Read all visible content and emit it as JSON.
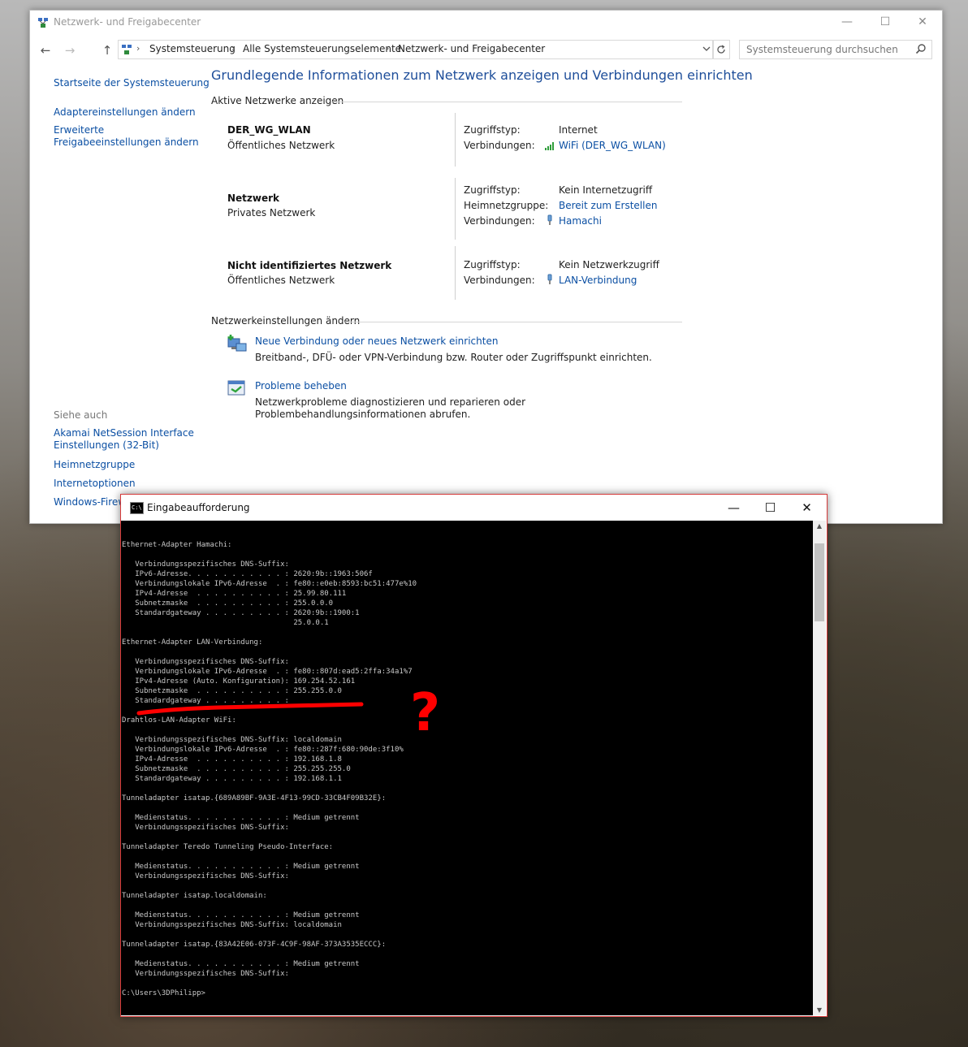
{
  "control_panel": {
    "title": "Netzwerk- und Freigabecenter",
    "window_controls": {
      "minimize": "—",
      "maximize": "☐",
      "close": "✕"
    },
    "nav": {
      "back": "←",
      "forward": "→",
      "up": "↑"
    },
    "breadcrumb": [
      "Systemsteuerung",
      "Alle Systemsteuerungselemente",
      "Netzwerk- und Freigabecenter"
    ],
    "breadcrumb_separator": "›",
    "search_placeholder": "Systemsteuerung durchsuchen",
    "sidebar": {
      "home": "Startseite der Systemsteuerung",
      "adapter": "Adaptereinstellungen ändern",
      "sharing_1": "Erweiterte",
      "sharing_2": "Freigabeeinstellungen ändern",
      "see_also": "Siehe auch",
      "akamai_1": "Akamai NetSession Interface",
      "akamai_2": "Einstellungen (32-Bit)",
      "homegroup": "Heimnetzgruppe",
      "internet_options": "Internetoptionen",
      "firewall": "Windows-Firewall"
    },
    "main_title": "Grundlegende Informationen zum Netzwerk anzeigen und Verbindungen einrichten",
    "active_networks_header": "Aktive Netzwerke anzeigen",
    "networks": [
      {
        "name": "DER_WG_WLAN",
        "type": "Öffentliches Netzwerk",
        "access_label": "Zugriffstyp:",
        "access_value": "Internet",
        "connections_label": "Verbindungen:",
        "connection": "WiFi (DER_WG_WLAN)"
      },
      {
        "name": "Netzwerk",
        "type": "Privates Netzwerk",
        "access_label": "Zugriffstyp:",
        "access_value": "Kein Internetzugriff",
        "homegroup_label": "Heimnetzgruppe:",
        "homegroup_value": "Bereit zum Erstellen",
        "connections_label": "Verbindungen:",
        "connection": "Hamachi"
      },
      {
        "name": "Nicht identifiziertes Netzwerk",
        "type": "Öffentliches Netzwerk",
        "access_label": "Zugriffstyp:",
        "access_value": "Kein Netzwerkzugriff",
        "connections_label": "Verbindungen:",
        "connection": "LAN-Verbindung"
      }
    ],
    "change_settings_header": "Netzwerkeinstellungen ändern",
    "tasks": [
      {
        "link": "Neue Verbindung oder neues Netzwerk einrichten",
        "desc": "Breitband-, DFÜ- oder VPN-Verbindung bzw. Router oder Zugriffspunkt einrichten.",
        "icon": "new-connection-icon"
      },
      {
        "link": "Probleme beheben",
        "desc": "Netzwerkprobleme diagnostizieren und reparieren oder Problembehandlungsinformationen abrufen.",
        "icon": "troubleshoot-icon"
      }
    ]
  },
  "cmd": {
    "title": "Eingabeaufforderung",
    "window_controls": {
      "minimize": "—",
      "maximize": "☐",
      "close": "✕"
    },
    "icon_label": "C:\\",
    "output": "Ethernet-Adapter Hamachi:\n\n   Verbindungsspezifisches DNS-Suffix:\n   IPv6-Adresse. . . . . . . . . . . : 2620:9b::1963:506f\n   Verbindungslokale IPv6-Adresse  . : fe80::e0eb:8593:bc51:477e%10\n   IPv4-Adresse  . . . . . . . . . . : 25.99.80.111\n   Subnetzmaske  . . . . . . . . . . : 255.0.0.0\n   Standardgateway . . . . . . . . . : 2620:9b::1900:1\n                                       25.0.0.1\n\nEthernet-Adapter LAN-Verbindung:\n\n   Verbindungsspezifisches DNS-Suffix:\n   Verbindungslokale IPv6-Adresse  . : fe80::807d:ead5:2ffa:34a1%7\n   IPv4-Adresse (Auto. Konfiguration): 169.254.52.161\n   Subnetzmaske  . . . . . . . . . . : 255.255.0.0\n   Standardgateway . . . . . . . . . :\n\nDrahtlos-LAN-Adapter WiFi:\n\n   Verbindungsspezifisches DNS-Suffix: localdomain\n   Verbindungslokale IPv6-Adresse  . : fe80::287f:680:90de:3f10%\n   IPv4-Adresse  . . . . . . . . . . : 192.168.1.8\n   Subnetzmaske  . . . . . . . . . . : 255.255.255.0\n   Standardgateway . . . . . . . . . : 192.168.1.1\n\nTunneladapter isatap.{689A89BF-9A3E-4F13-99CD-33CB4F09B32E}:\n\n   Medienstatus. . . . . . . . . . . : Medium getrennt\n   Verbindungsspezifisches DNS-Suffix:\n\nTunneladapter Teredo Tunneling Pseudo-Interface:\n\n   Medienstatus. . . . . . . . . . . : Medium getrennt\n   Verbindungsspezifisches DNS-Suffix:\n\nTunneladapter isatap.localdomain:\n\n   Medienstatus. . . . . . . . . . . : Medium getrennt\n   Verbindungsspezifisches DNS-Suffix: localdomain\n\nTunneladapter isatap.{83A42E06-073F-4C9F-98AF-373A3535ECCC}:\n\n   Medienstatus. . . . . . . . . . . : Medium getrennt\n   Verbindungsspezifisches DNS-Suffix:\n\nC:\\Users\\3DPhilipp>",
    "scroll_up": "▲",
    "scroll_down": "▼"
  },
  "annotation": {
    "color": "#ff0000",
    "mark": "?"
  }
}
